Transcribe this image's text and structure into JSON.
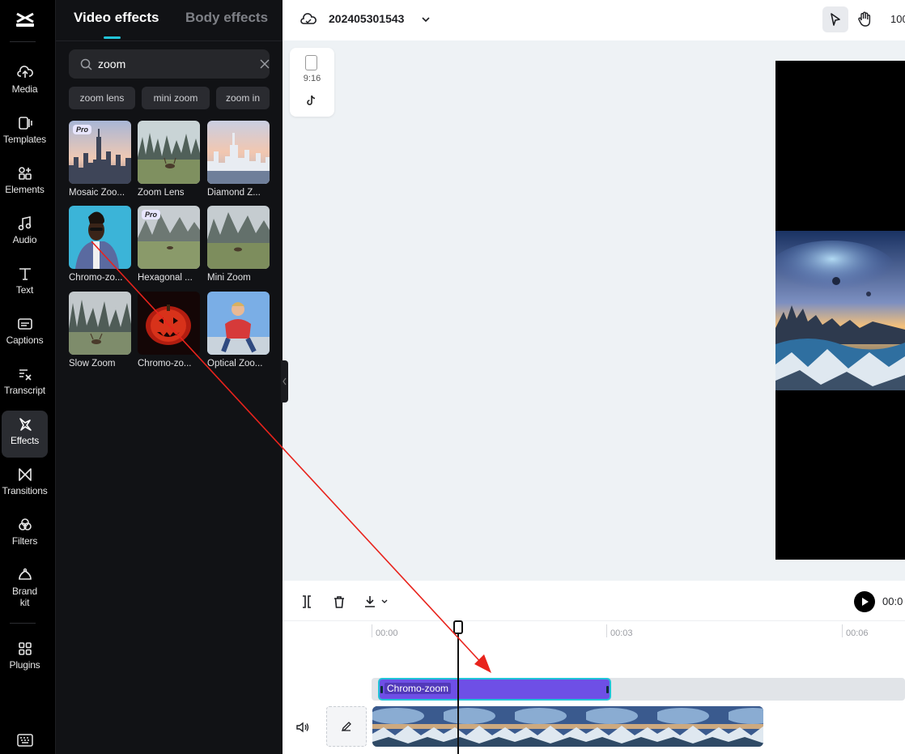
{
  "nav": {
    "items": [
      {
        "label": "Media"
      },
      {
        "label": "Templates"
      },
      {
        "label": "Elements"
      },
      {
        "label": "Audio"
      },
      {
        "label": "Text"
      },
      {
        "label": "Captions"
      },
      {
        "label": "Transcript"
      },
      {
        "label": "Effects"
      },
      {
        "label": "Transitions"
      },
      {
        "label": "Filters"
      },
      {
        "label": "Brand kit"
      },
      {
        "label": "Plugins"
      }
    ],
    "active": "Effects"
  },
  "panel": {
    "tabs": [
      {
        "label": "Video effects"
      },
      {
        "label": "Body effects"
      }
    ],
    "search": {
      "value": "zoom",
      "placeholder": ""
    },
    "chips": [
      {
        "label": "zoom lens"
      },
      {
        "label": "mini zoom"
      },
      {
        "label": "zoom in"
      }
    ],
    "cards": [
      {
        "name": "Mosaic Zoo...",
        "pro": "Pro"
      },
      {
        "name": "Zoom Lens"
      },
      {
        "name": "Diamond Z..."
      },
      {
        "name": "Chromo-zo..."
      },
      {
        "name": "Hexagonal ...",
        "pro": "Pro"
      },
      {
        "name": "Mini Zoom"
      },
      {
        "name": "Slow Zoom"
      },
      {
        "name": "Chromo-zo..."
      },
      {
        "name": "Optical Zoo..."
      }
    ]
  },
  "topbar": {
    "project_name": "202405301543",
    "zoom": "100"
  },
  "canvas": {
    "ratio_label": "9:16"
  },
  "timeline": {
    "current_time": "00:0",
    "ticks": [
      "00:00",
      "00:03",
      "00:06"
    ],
    "effect_clip": {
      "label": "Chromo-zoom"
    }
  },
  "colors": {
    "accent": "#22c4d8",
    "effect_clip": "#6e4fe6",
    "drag_arrow": "#e8231c"
  }
}
